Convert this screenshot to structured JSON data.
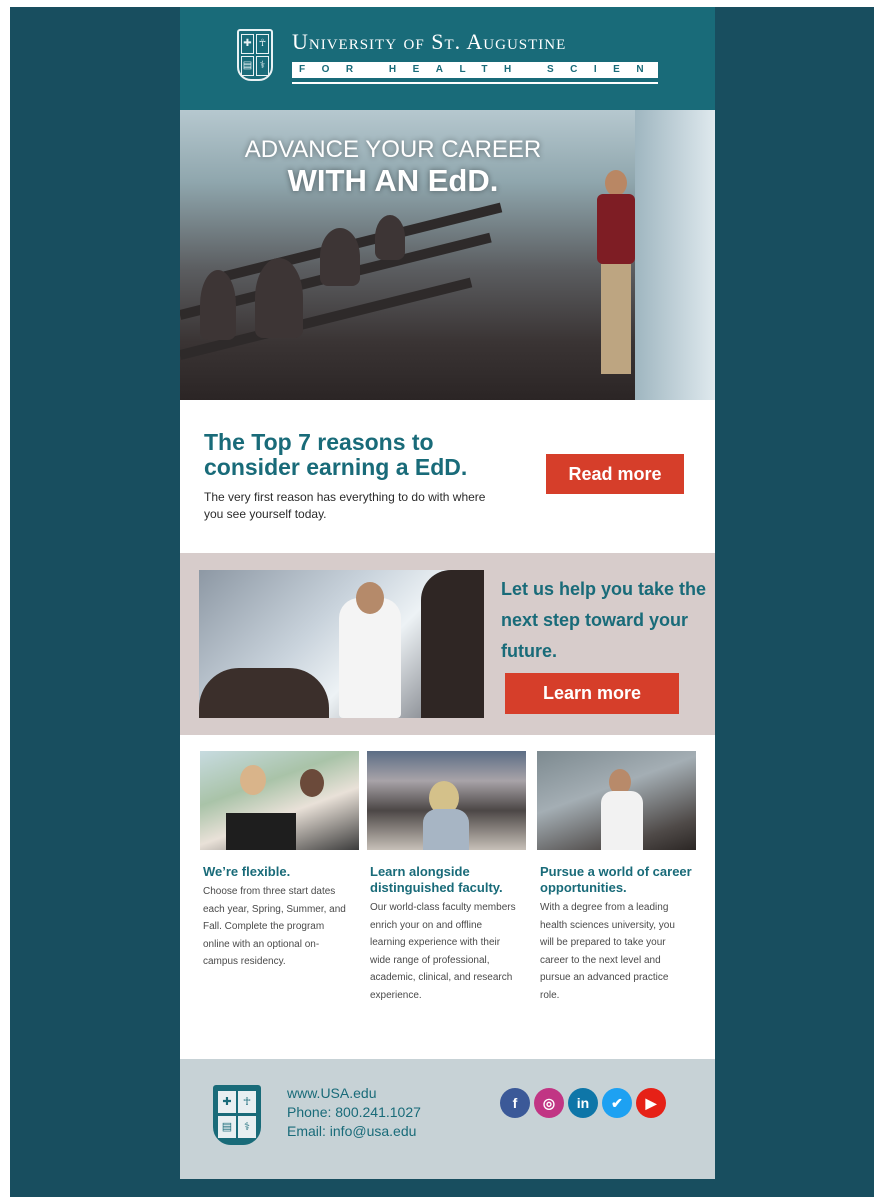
{
  "header": {
    "university_name": "University of St. Augustine",
    "tagline": "FOR HEALTH SCIENCES"
  },
  "hero": {
    "line1": "ADVANCE YOUR CAREER",
    "line2": "WITH AN EdD."
  },
  "reasons": {
    "heading": "The Top 7 reasons to consider earning a EdD.",
    "body": "The very first reason has everything to do with where you see yourself today.",
    "button_label": "Read more"
  },
  "help": {
    "heading": "Let us help you take the next step toward your future.",
    "button_label": "Learn more"
  },
  "features": [
    {
      "title": "We’re flexible.",
      "body": "Choose from three start dates each year, Spring, Summer, and Fall. Complete the program online with an optional on-campus residency."
    },
    {
      "title": "Learn alongside distinguished faculty.",
      "body": "Our world-class faculty members enrich your on and offline learning experience with their wide range of professional, academic, clinical, and research experience."
    },
    {
      "title": "Pursue a world of career opportunities.",
      "body": "With a degree from a leading health sciences university, you will be prepared to take your career to the next level and pursue an advanced practice role."
    }
  ],
  "footer": {
    "website": "www.USA.edu",
    "phone": "Phone: 800.241.1027",
    "email": "Email: info@usa.edu"
  },
  "social": [
    {
      "icon": "facebook-icon",
      "glyph": "f",
      "color": "#3b5998"
    },
    {
      "icon": "instagram-icon",
      "glyph": "◎",
      "color": "#c13584"
    },
    {
      "icon": "linkedin-icon",
      "glyph": "in",
      "color": "#0e76a8"
    },
    {
      "icon": "twitter-icon",
      "glyph": "✔",
      "color": "#1da1f2"
    },
    {
      "icon": "youtube-icon",
      "glyph": "▶",
      "color": "#e62117"
    }
  ],
  "colors": {
    "brand_teal": "#196b79",
    "frame_dark_teal": "#184e5f",
    "cta_red": "#d63e2a",
    "help_band": "#d7cccb",
    "footer_band": "#c7d2d6"
  }
}
